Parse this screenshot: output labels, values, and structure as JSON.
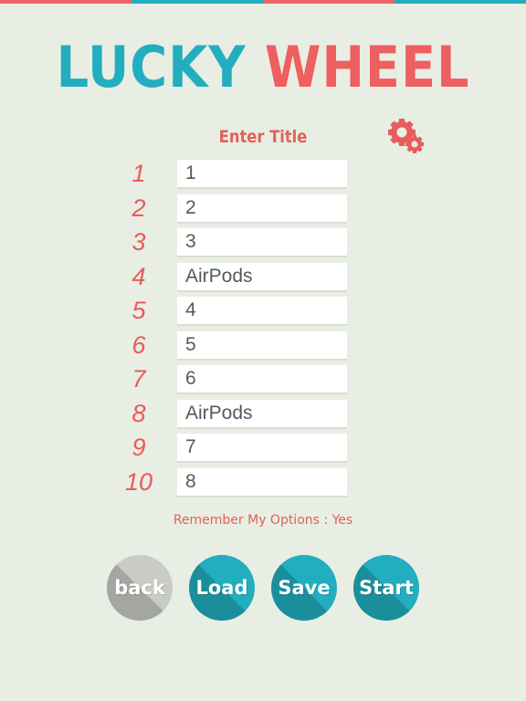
{
  "colors": {
    "background": "#e8eee3",
    "teal": "#22aebf",
    "coral": "#ee5f5f",
    "gray_button": "#c8cbc6"
  },
  "header": {
    "title_word1": "LUCKY",
    "title_word2": "WHEEL"
  },
  "title_field": {
    "placeholder": "Enter Title"
  },
  "settings_icon": "gear-icon",
  "options": [
    {
      "number": "1",
      "value": "1"
    },
    {
      "number": "2",
      "value": "2"
    },
    {
      "number": "3",
      "value": "3"
    },
    {
      "number": "4",
      "value": "AirPods"
    },
    {
      "number": "5",
      "value": "4"
    },
    {
      "number": "6",
      "value": "5"
    },
    {
      "number": "7",
      "value": "6"
    },
    {
      "number": "8",
      "value": "AirPods"
    },
    {
      "number": "9",
      "value": "7"
    },
    {
      "number": "10",
      "value": "8"
    }
  ],
  "remember": {
    "text": "Remember My Options : Yes"
  },
  "buttons": {
    "back": "back",
    "load": "Load",
    "save": "Save",
    "start": "Start"
  }
}
